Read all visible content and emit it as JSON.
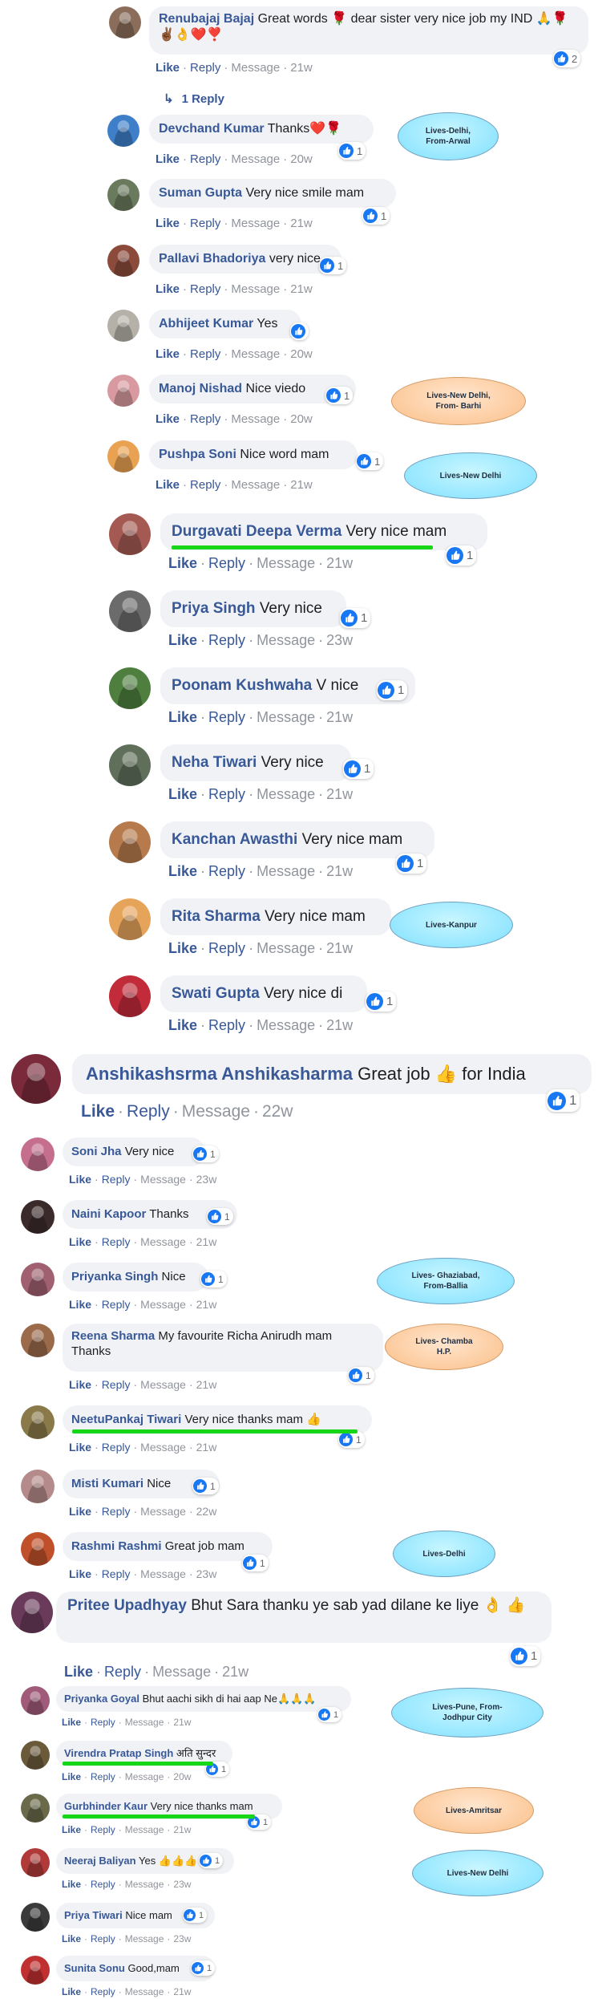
{
  "labels": {
    "like": "Like",
    "reply": "Reply",
    "message": "Message",
    "sep": "·"
  },
  "comments": [
    {
      "name": "Renubajaj Bajaj",
      "text": "Great words 🌹 dear sister very nice job my IND 🙏🌹✌🏾👌❤️❣️",
      "time": "21w",
      "reactions": "2",
      "avatar_color": "#8a6d5a"
    },
    {
      "name": "Devchand Kumar",
      "text": "Thanks❤️🌹",
      "time": "20w",
      "reactions": "1",
      "avatar_color": "#3f7fc9"
    },
    {
      "name": "Suman Gupta",
      "text": "Very nice smile mam",
      "time": "21w",
      "reactions": "1",
      "avatar_color": "#6a7a5c"
    },
    {
      "name": "Pallavi Bhadoriya",
      "text": "very nice",
      "time": "21w",
      "reactions": "1",
      "avatar_color": "#8c4a3a"
    },
    {
      "name": "Abhijeet Kumar",
      "text": "Yes",
      "time": "20w",
      "reactions": "",
      "avatar_color": "#b5b0a8"
    },
    {
      "name": "Manoj Nishad",
      "text": "Nice viedo",
      "time": "20w",
      "reactions": "1",
      "avatar_color": "#d89aa0"
    },
    {
      "name": "Pushpa Soni",
      "text": "Nice word mam",
      "time": "21w",
      "reactions": "1",
      "avatar_color": "#e9a152"
    },
    {
      "name": "Durgavati Deepa Verma",
      "text": "Very nice mam",
      "time": "21w",
      "reactions": "1",
      "avatar_color": "#a45a52"
    },
    {
      "name": "Priya Singh",
      "text": "Very nice",
      "time": "23w",
      "reactions": "1",
      "avatar_color": "#6b6b6b"
    },
    {
      "name": "Poonam Kushwaha",
      "text": "V nice",
      "time": "21w",
      "reactions": "1",
      "avatar_color": "#4e7f3e"
    },
    {
      "name": "Neha Tiwari",
      "text": "Very nice",
      "time": "21w",
      "reactions": "1",
      "avatar_color": "#5f6f5a"
    },
    {
      "name": "Kanchan Awasthi",
      "text": "Very nice mam",
      "time": "21w",
      "reactions": "1",
      "avatar_color": "#b67a4c"
    },
    {
      "name": "Rita Sharma",
      "text": "Very nice mam",
      "time": "21w",
      "reactions": "",
      "avatar_color": "#e6a35a"
    },
    {
      "name": "Swati Gupta",
      "text": "Very nice di",
      "time": "21w",
      "reactions": "1",
      "avatar_color": "#c12b3a"
    },
    {
      "name": "Anshikashsrma Anshikasharma",
      "text": "Great job 👍 for India",
      "time": "22w",
      "reactions": "1",
      "avatar_color": "#7a2a3a"
    },
    {
      "name": "Soni Jha",
      "text": "Very nice",
      "time": "23w",
      "reactions": "1",
      "avatar_color": "#c56e8e"
    },
    {
      "name": "Naini Kapoor",
      "text": "Thanks",
      "time": "21w",
      "reactions": "1",
      "avatar_color": "#3a2a2a"
    },
    {
      "name": "Priyanka Singh",
      "text": "Nice",
      "time": "21w",
      "reactions": "1",
      "avatar_color": "#a06070"
    },
    {
      "name": "Reena Sharma",
      "text": "My favourite Richa Anirudh mam Thanks",
      "time": "21w",
      "reactions": "1",
      "avatar_color": "#9a6a4a"
    },
    {
      "name": "NeetuPankaj Tiwari",
      "text": "Very nice thanks mam 👍",
      "time": "21w",
      "reactions": "1",
      "avatar_color": "#8a7a4a"
    },
    {
      "name": "Misti Kumari",
      "text": "Nice",
      "time": "22w",
      "reactions": "1",
      "avatar_color": "#b58a8a"
    },
    {
      "name": "Rashmi Rashmi",
      "text": "Great job mam",
      "time": "23w",
      "reactions": "1",
      "avatar_color": "#c0502a"
    },
    {
      "name": "Pritee Upadhyay",
      "text": "Bhut Sara thanku ye sab yad dilane ke liye 👌 👍",
      "time": "21w",
      "reactions": "1",
      "avatar_color": "#6a3a5a"
    },
    {
      "name": "Priyanka Goyal",
      "text": "Bhut aachi sikh di hai aap Ne🙏🙏🙏",
      "time": "21w",
      "reactions": "1",
      "avatar_color": "#a05a7a"
    },
    {
      "name": "Virendra Pratap Singh",
      "text": "अति सुन्दर",
      "time": "20w",
      "reactions": "1",
      "avatar_color": "#6a5a3a"
    },
    {
      "name": "Gurbhinder Kaur",
      "text": "Very nice thanks mam",
      "time": "21w",
      "reactions": "1",
      "avatar_color": "#6a6a4a"
    },
    {
      "name": "Neeraj Baliyan",
      "text": "Yes 👍👍👍",
      "time": "23w",
      "reactions": "1",
      "avatar_color": "#b03a3a"
    },
    {
      "name": "Priya Tiwari",
      "text": "Nice mam",
      "time": "23w",
      "reactions": "1",
      "avatar_color": "#3a3a3a"
    },
    {
      "name": "Sunita Sonu",
      "text": "Good,mam",
      "time": "21w",
      "reactions": "1",
      "avatar_color": "#c03030"
    }
  ],
  "reply_link": {
    "label": "1 Reply"
  },
  "annotations": [
    {
      "text": "Lives-Delhi,\nFrom-Arwal",
      "style": "blue"
    },
    {
      "text": "Lives-New Delhi,\nFrom- Barhi",
      "style": "orange"
    },
    {
      "text": "Lives-New Delhi",
      "style": "blue"
    },
    {
      "text": "Lives-Kanpur",
      "style": "blue"
    },
    {
      "text": "Lives- Ghaziabad,\nFrom-Ballia",
      "style": "blue"
    },
    {
      "text": "Lives- Chamba\nH.P.",
      "style": "orange"
    },
    {
      "text": "Lives-Delhi",
      "style": "blue"
    },
    {
      "text": "Lives-Pune, From-\nJodhpur City",
      "style": "blue"
    },
    {
      "text": "Lives-Amritsar",
      "style": "orange"
    },
    {
      "text": "Lives-New Delhi",
      "style": "blue"
    }
  ]
}
